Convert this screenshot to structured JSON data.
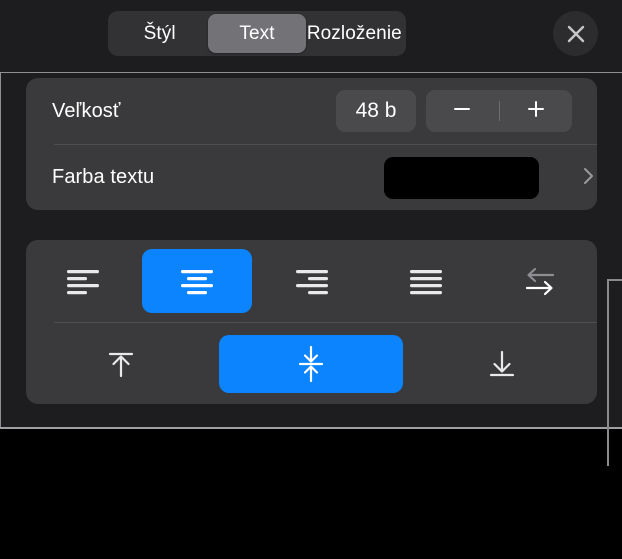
{
  "window": {
    "title": "Text Format Popover",
    "background_color": "#000000",
    "panel_color": "#1d1d1f",
    "card_color": "#3a3a3c",
    "accent_color": "#0b84fe"
  },
  "header": {
    "tabs": [
      {
        "label": "Štýl",
        "selected": false,
        "name": "tab-style"
      },
      {
        "label": "Text",
        "selected": true,
        "name": "tab-text"
      },
      {
        "label": "Rozloženie",
        "selected": false,
        "name": "tab-layout"
      }
    ],
    "close_icon": "close-icon",
    "close_label": "×"
  },
  "format_card": {
    "size_row": {
      "label": "Veľkosť",
      "value": "48 b",
      "decrease_icon": "minus-icon",
      "increase_icon": "plus-icon"
    },
    "color_row": {
      "label": "Farba textu",
      "swatch_color": "#000000",
      "disclosure_icon": "chevron-right-icon"
    }
  },
  "alignment_card": {
    "horizontal": [
      {
        "name": "align-left-button",
        "icon": "align-left-icon",
        "selected": false
      },
      {
        "name": "align-center-button",
        "icon": "align-center-icon",
        "selected": true
      },
      {
        "name": "align-right-button",
        "icon": "align-right-icon",
        "selected": false
      },
      {
        "name": "align-justify-button",
        "icon": "align-justify-icon",
        "selected": false
      },
      {
        "name": "text-direction-button",
        "icon": "text-direction-icon",
        "selected": false
      }
    ],
    "vertical": [
      {
        "name": "align-top-button",
        "icon": "align-top-icon",
        "selected": false
      },
      {
        "name": "align-middle-button",
        "icon": "align-middle-icon",
        "selected": true
      },
      {
        "name": "align-bottom-button",
        "icon": "align-bottom-icon",
        "selected": false
      }
    ]
  },
  "callout": {
    "name": "callout-bracket",
    "color": "#8a8a8e"
  }
}
